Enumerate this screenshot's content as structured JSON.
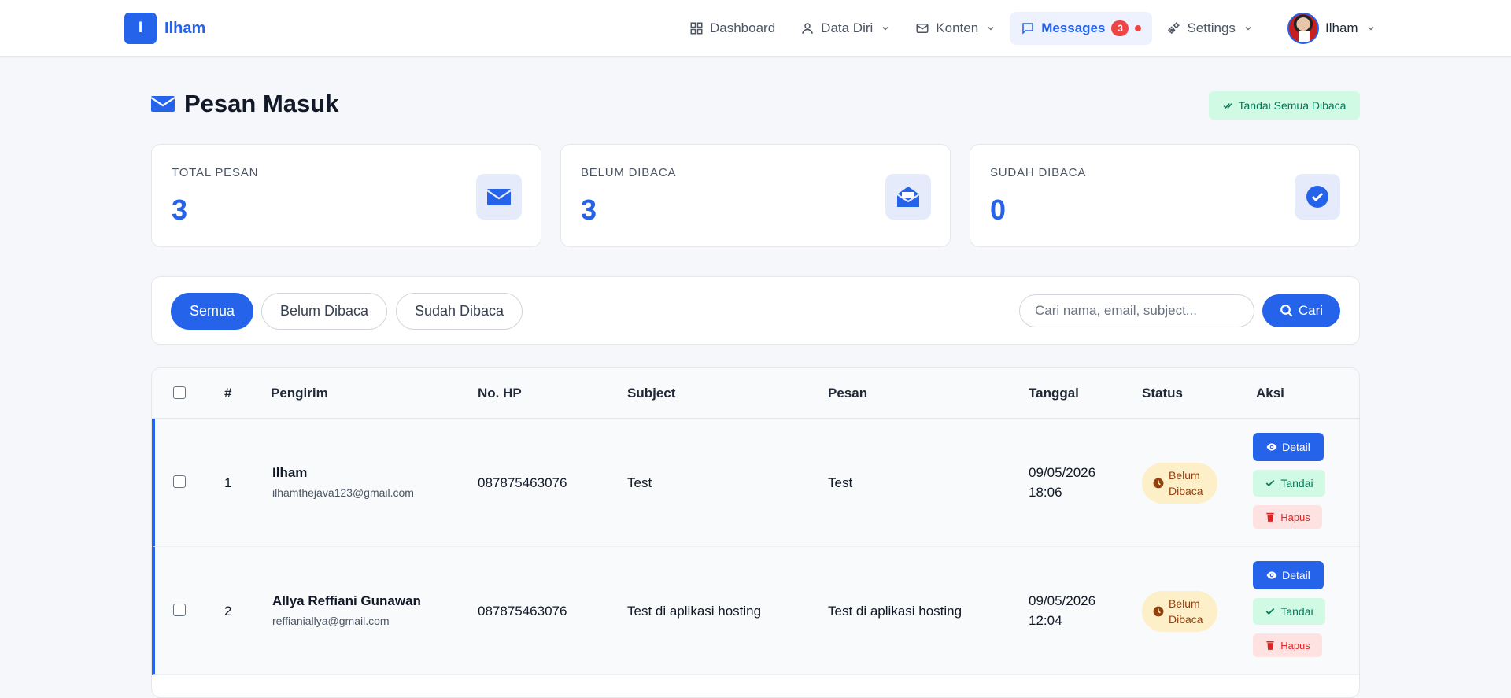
{
  "app": {
    "brand_letter": "I",
    "brand_name": "Ilham",
    "brand_color": "#2563eb"
  },
  "nav": {
    "dashboard": "Dashboard",
    "data_diri": "Data Diri",
    "konten": "Konten",
    "messages": "Messages",
    "messages_badge": "3",
    "settings": "Settings",
    "user_name": "Ilham"
  },
  "page": {
    "title": "Pesan Masuk",
    "mark_all": "Tandai Semua Dibaca"
  },
  "stats": [
    {
      "label": "TOTAL PESAN",
      "value": "3",
      "icon": "envelope-icon"
    },
    {
      "label": "BELUM DIBACA",
      "value": "3",
      "icon": "envelope-open-icon"
    },
    {
      "label": "SUDAH DIBACA",
      "value": "0",
      "icon": "check-circle-icon"
    }
  ],
  "filters": {
    "all": "Semua",
    "unread": "Belum Dibaca",
    "read": "Sudah Dibaca",
    "active": "Semua",
    "search_placeholder": "Cari nama, email, subject...",
    "search_button": "Cari"
  },
  "table": {
    "columns": [
      "#",
      "Pengirim",
      "No. HP",
      "Subject",
      "Pesan",
      "Tanggal",
      "Status",
      "Aksi"
    ],
    "rows": [
      {
        "no": "1",
        "name": "Ilham",
        "email": "ilhamthejava123@gmail.com",
        "phone": "087875463076",
        "subject": "Test",
        "message": "Test",
        "date": "09/05/2026",
        "time": "18:06",
        "status": "Belum Dibaca"
      },
      {
        "no": "2",
        "name": "Allya Reffiani Gunawan",
        "email": "reffianiallya@gmail.com",
        "phone": "087875463076",
        "subject": "Test di aplikasi hosting",
        "message": "Test di aplikasi hosting",
        "date": "09/05/2026",
        "time": "12:04",
        "status": "Belum Dibaca"
      }
    ],
    "actions": {
      "detail": "Detail",
      "mark": "Tandai",
      "delete": "Hapus"
    }
  }
}
